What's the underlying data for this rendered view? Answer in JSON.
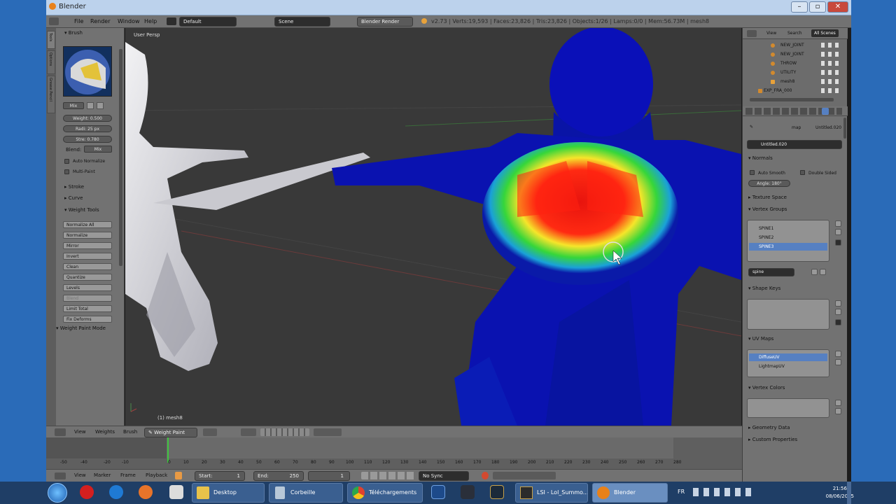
{
  "window": {
    "title": "Blender"
  },
  "info": {
    "menus": [
      "File",
      "Render",
      "Window",
      "Help"
    ],
    "layout": "Default",
    "scene": "Scene",
    "engine": "Blender Render",
    "stats": "v2.73 | Verts:19,593 | Faces:23,826 | Tris:23,826 | Objects:1/26 | Lamps:0/0 | Mem:56.73M | mesh8"
  },
  "tools": {
    "tabs": [
      "Tools",
      "Options",
      "Grease Pencil"
    ],
    "brush_header": "Brush",
    "mix": "Mix",
    "weight": "Weight: 0.500",
    "radius": "Radi: 25 px",
    "strength": "Stre: 0.780",
    "blend_label": "Blend:",
    "blend_value": "Mix",
    "auto_normalize": "Auto Normalize",
    "multi_paint": "Multi-Paint",
    "stroke": "Stroke",
    "curve": "Curve",
    "weight_tools": "Weight Tools",
    "buttons": [
      "Normalize All",
      "Normalize",
      "Mirror",
      "Invert",
      "Clean",
      "Quantize",
      "Levels",
      "Blend",
      "Limit Total",
      "Fix Deforms"
    ],
    "mode_panel": "Weight Paint Mode"
  },
  "viewport": {
    "view_label": "User Persp",
    "object_label": "(1) mesh8"
  },
  "vp_header": {
    "menus": [
      "View",
      "Weights",
      "Brush"
    ],
    "mode": "Weight Paint"
  },
  "timeline": {
    "ticks": [
      "-50",
      "-40",
      "-20",
      "-10",
      "0",
      "10",
      "20",
      "30",
      "40",
      "50",
      "60",
      "70",
      "80",
      "90",
      "100",
      "110",
      "120",
      "130",
      "140",
      "150",
      "160",
      "170",
      "180",
      "190",
      "200",
      "210",
      "220",
      "230",
      "240",
      "250",
      "260",
      "270",
      "280"
    ],
    "menus": [
      "View",
      "Marker",
      "Frame",
      "Playback"
    ],
    "start": "Start:",
    "start_val": "1",
    "end": "End:",
    "end_val": "250",
    "current": "1",
    "sync": "No Sync"
  },
  "outliner": {
    "tabs": [
      "View",
      "Search",
      "All Scenes"
    ],
    "items": [
      "NEW_JOINT",
      "NEW_JOINT",
      "THROW",
      "UTILITY",
      "mesh8",
      "EXP_FRA_000"
    ]
  },
  "props": {
    "breadcrumb": "map",
    "breadcrumb2": "Untitled.020",
    "datablock": "Untitled.020",
    "normals": "Normals",
    "auto_smooth": "Auto Smooth",
    "double_sided": "Double Sided",
    "angle": "Angle: 180°",
    "texture_space": "Texture Space",
    "vertex_groups": "Vertex Groups",
    "groups": [
      "SPINE1",
      "SPINE2",
      "SPINE3"
    ],
    "group_filter": "spine",
    "shape_keys": "Shape Keys",
    "uv_maps": "UV Maps",
    "uvs": [
      "DiffuseUV",
      "LightmapUV"
    ],
    "vertex_colors": "Vertex Colors",
    "geometry_data": "Geometry Data",
    "custom_properties": "Custom Properties"
  },
  "taskbar": {
    "items": [
      "Desktop",
      "Corbeille",
      "Téléchargements",
      "LSI - Lol_Summo...",
      "Blender"
    ],
    "lang": "FR",
    "time": "21:56",
    "date": "08/06/2015"
  }
}
